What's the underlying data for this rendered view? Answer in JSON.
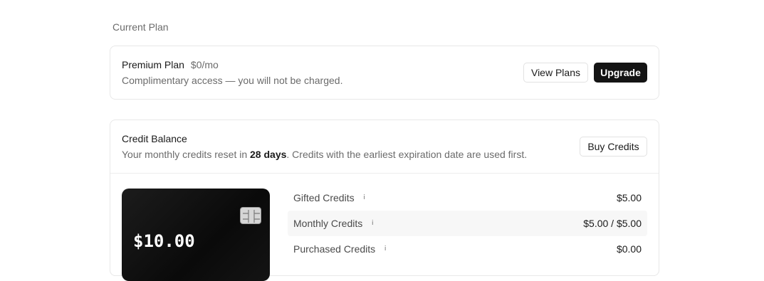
{
  "section": {
    "title": "Current Plan"
  },
  "plan": {
    "name": "Premium Plan",
    "price": "$0/mo",
    "description": "Complimentary access — you will not be charged.",
    "view_plans_label": "View Plans",
    "upgrade_label": "Upgrade"
  },
  "credits": {
    "title": "Credit Balance",
    "desc_prefix": "Your monthly credits reset in ",
    "reset_days": "28 days",
    "desc_suffix": ". Credits with the earliest expiration date are used first.",
    "buy_label": "Buy Credits",
    "balance": "$10.00",
    "rows": [
      {
        "label": "Gifted Credits",
        "value": "$5.00"
      },
      {
        "label": "Monthly Credits",
        "value": "$5.00 / $5.00"
      },
      {
        "label": "Purchased Credits",
        "value": "$0.00"
      }
    ]
  },
  "icons": {
    "info": "info-icon",
    "chip": "card-chip-icon"
  }
}
